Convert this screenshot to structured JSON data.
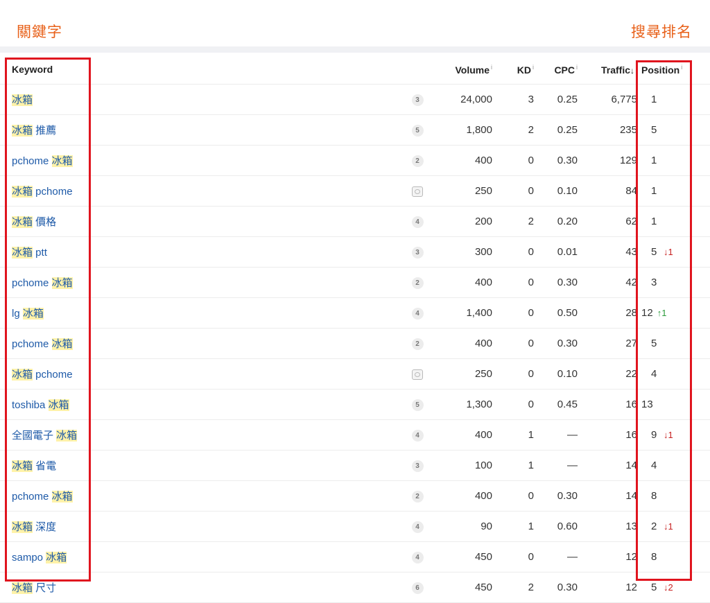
{
  "annotations": {
    "left": "關鍵字",
    "right": "搜尋排名"
  },
  "columns": {
    "keyword": "Keyword",
    "volume": "Volume",
    "kd": "KD",
    "cpc": "CPC",
    "traffic": "Traffic",
    "position": "Position",
    "info": "i",
    "sort_arrow": "↓"
  },
  "rows": [
    {
      "kw_pre": "",
      "kw_hl": "冰箱",
      "kw_post": "",
      "sf": "3",
      "sf_icon": "",
      "volume": "24,000",
      "kd": "3",
      "cpc": "0.25",
      "traffic": "6,775",
      "position": "1",
      "change": "",
      "change_dir": ""
    },
    {
      "kw_pre": "",
      "kw_hl": "冰箱",
      "kw_post": " 推薦",
      "sf": "5",
      "sf_icon": "",
      "volume": "1,800",
      "kd": "2",
      "cpc": "0.25",
      "traffic": "235",
      "position": "5",
      "change": "",
      "change_dir": ""
    },
    {
      "kw_pre": "pchome ",
      "kw_hl": "冰箱",
      "kw_post": "",
      "sf": "2",
      "sf_icon": "",
      "volume": "400",
      "kd": "0",
      "cpc": "0.30",
      "traffic": "129",
      "position": "1",
      "change": "",
      "change_dir": ""
    },
    {
      "kw_pre": "",
      "kw_hl": "冰箱",
      "kw_post": " pchome",
      "sf": "",
      "sf_icon": "image-pack-icon",
      "volume": "250",
      "kd": "0",
      "cpc": "0.10",
      "traffic": "84",
      "position": "1",
      "change": "",
      "change_dir": ""
    },
    {
      "kw_pre": "",
      "kw_hl": "冰箱",
      "kw_post": " 價格",
      "sf": "4",
      "sf_icon": "",
      "volume": "200",
      "kd": "2",
      "cpc": "0.20",
      "traffic": "62",
      "position": "1",
      "change": "",
      "change_dir": ""
    },
    {
      "kw_pre": "",
      "kw_hl": "冰箱",
      "kw_post": " ptt",
      "sf": "3",
      "sf_icon": "",
      "volume": "300",
      "kd": "0",
      "cpc": "0.01",
      "traffic": "43",
      "position": "5",
      "change": "↓1",
      "change_dir": "down"
    },
    {
      "kw_pre": "pchome ",
      "kw_hl": "冰箱",
      "kw_post": "",
      "sf": "2",
      "sf_icon": "",
      "volume": "400",
      "kd": "0",
      "cpc": "0.30",
      "traffic": "42",
      "position": "3",
      "change": "",
      "change_dir": ""
    },
    {
      "kw_pre": "lg ",
      "kw_hl": "冰箱",
      "kw_post": "",
      "sf": "4",
      "sf_icon": "",
      "volume": "1,400",
      "kd": "0",
      "cpc": "0.50",
      "traffic": "28",
      "position": "12",
      "change": "↑1",
      "change_dir": "up"
    },
    {
      "kw_pre": "pchome ",
      "kw_hl": "冰箱",
      "kw_post": "",
      "sf": "2",
      "sf_icon": "",
      "volume": "400",
      "kd": "0",
      "cpc": "0.30",
      "traffic": "27",
      "position": "5",
      "change": "",
      "change_dir": ""
    },
    {
      "kw_pre": "",
      "kw_hl": "冰箱",
      "kw_post": " pchome",
      "sf": "",
      "sf_icon": "image-pack-icon",
      "volume": "250",
      "kd": "0",
      "cpc": "0.10",
      "traffic": "22",
      "position": "4",
      "change": "",
      "change_dir": ""
    },
    {
      "kw_pre": "toshiba ",
      "kw_hl": "冰箱",
      "kw_post": "",
      "sf": "5",
      "sf_icon": "",
      "volume": "1,300",
      "kd": "0",
      "cpc": "0.45",
      "traffic": "16",
      "position": "13",
      "change": "",
      "change_dir": ""
    },
    {
      "kw_pre": "全國電子 ",
      "kw_hl": "冰箱",
      "kw_post": "",
      "sf": "4",
      "sf_icon": "",
      "volume": "400",
      "kd": "1",
      "cpc": "—",
      "traffic": "16",
      "position": "9",
      "change": "↓1",
      "change_dir": "down"
    },
    {
      "kw_pre": "",
      "kw_hl": "冰箱",
      "kw_post": " 省電",
      "sf": "3",
      "sf_icon": "",
      "volume": "100",
      "kd": "1",
      "cpc": "—",
      "traffic": "14",
      "position": "4",
      "change": "",
      "change_dir": ""
    },
    {
      "kw_pre": "pchome ",
      "kw_hl": "冰箱",
      "kw_post": "",
      "sf": "2",
      "sf_icon": "",
      "volume": "400",
      "kd": "0",
      "cpc": "0.30",
      "traffic": "14",
      "position": "8",
      "change": "",
      "change_dir": ""
    },
    {
      "kw_pre": "",
      "kw_hl": "冰箱",
      "kw_post": " 深度",
      "sf": "4",
      "sf_icon": "",
      "volume": "90",
      "kd": "1",
      "cpc": "0.60",
      "traffic": "13",
      "position": "2",
      "change": "↓1",
      "change_dir": "down"
    },
    {
      "kw_pre": "sampo ",
      "kw_hl": "冰箱",
      "kw_post": "",
      "sf": "4",
      "sf_icon": "",
      "volume": "450",
      "kd": "0",
      "cpc": "—",
      "traffic": "12",
      "position": "8",
      "change": "",
      "change_dir": ""
    },
    {
      "kw_pre": "",
      "kw_hl": "冰箱",
      "kw_post": " 尺寸",
      "sf": "6",
      "sf_icon": "",
      "volume": "450",
      "kd": "2",
      "cpc": "0.30",
      "traffic": "12",
      "position": "5",
      "change": "↓2",
      "change_dir": "down"
    }
  ],
  "colors": {
    "link": "#1e5aa8",
    "highlight": "#fff2a8",
    "annotation": "#e8611a",
    "box": "#e0141e",
    "down": "#c61f1f",
    "up": "#2a9a3a"
  }
}
